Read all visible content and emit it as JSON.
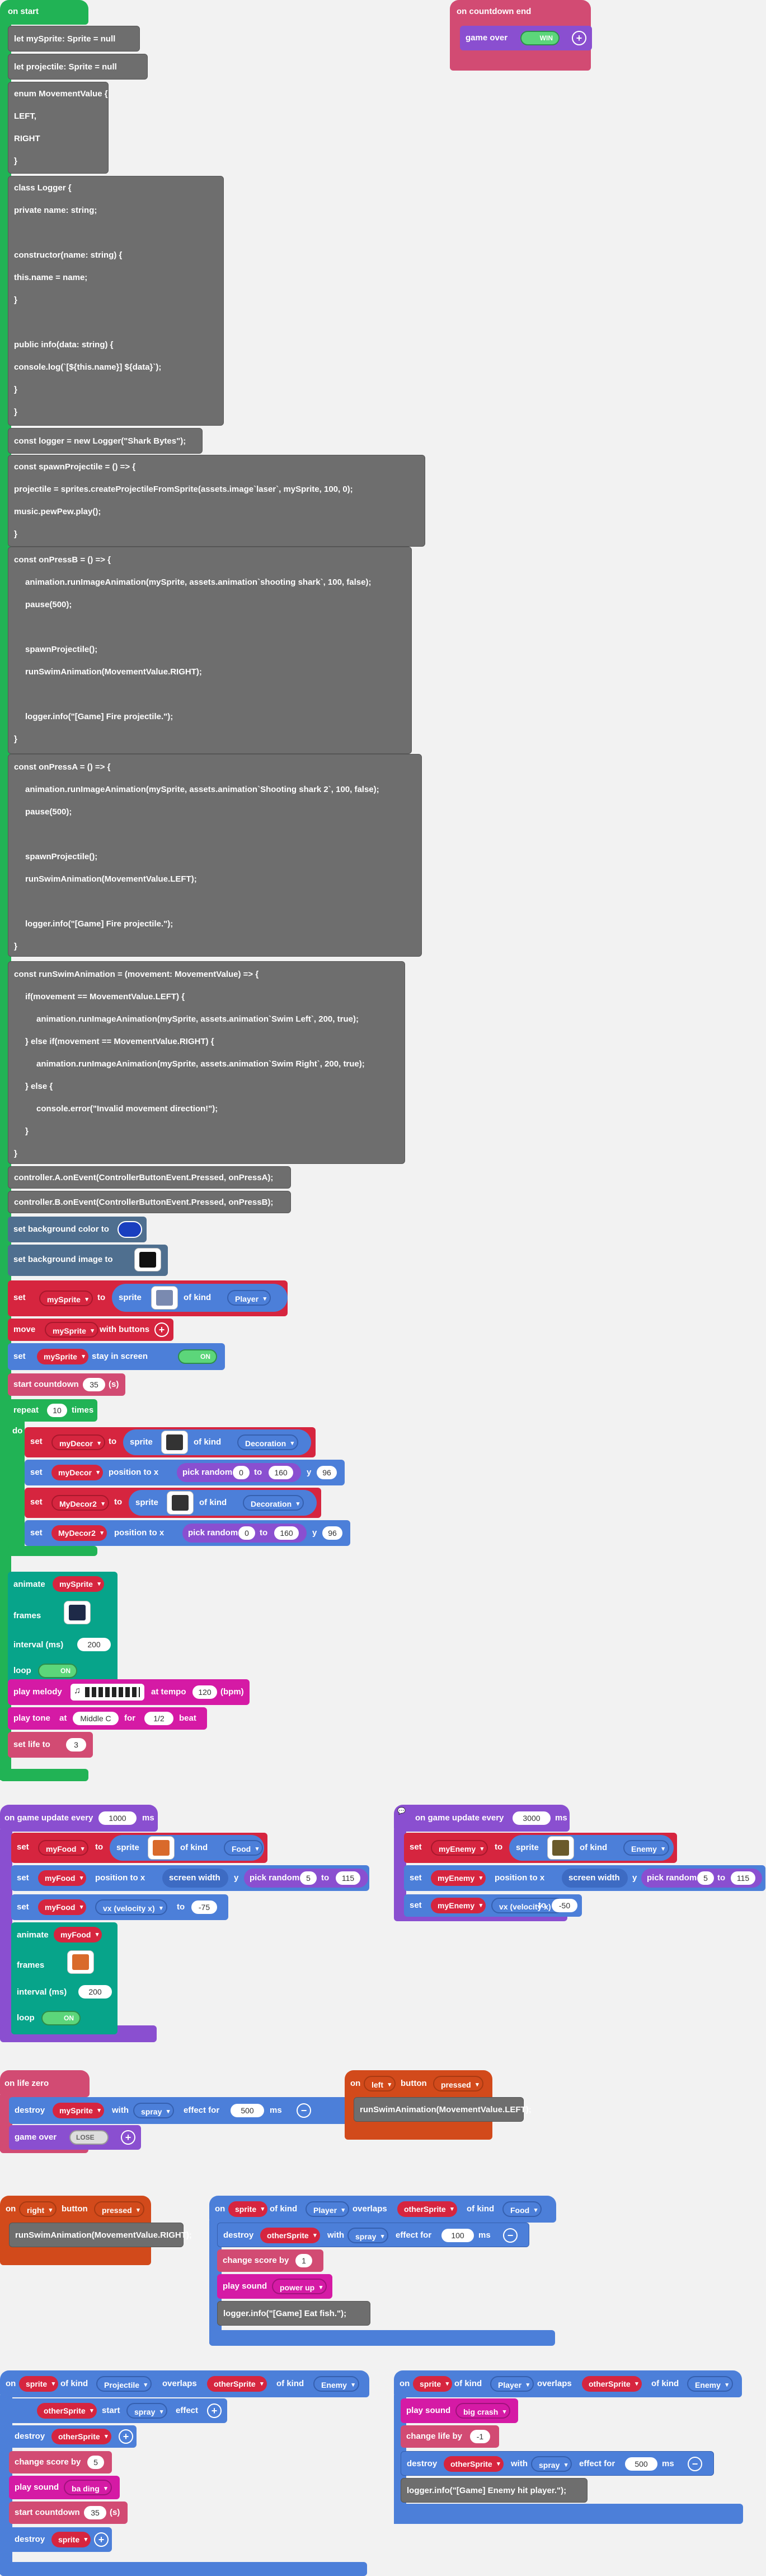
{
  "colors": {
    "code": "#6e6e6e",
    "green": "#21b355",
    "red": "#d6253f",
    "blue": "#4c7fd9",
    "pink": "#d24b73",
    "purple": "#8a4fd0",
    "orange": "#d24a1b",
    "magenta": "#d51aa5"
  },
  "on_start": {
    "label": "on start",
    "code": [
      "let mySprite: Sprite = null",
      "let projectile: Sprite = null",
      "enum MovementValue {",
      "    LEFT,",
      "    RIGHT",
      "}",
      "class Logger {",
      "    private name: string;",
      "    constructor(name: string) {",
      "        this.name = name;",
      "    }",
      "    public info(data: string) {",
      "        console.log(`[${this.name}] ${data}`);",
      "    }",
      "}",
      "const logger = new Logger(\"Shark Bytes\");",
      "const spawnProjectile = () => {",
      "    projectile = sprites.createProjectileFromSprite(assets.image`laser`, mySprite, 100, 0);",
      "    music.pewPew.play();",
      "}",
      "const onPressB = () => {",
      "    animation.runImageAnimation(mySprite, assets.animation`shooting shark`, 100, false);",
      "    pause(500);",
      "    spawnProjectile();",
      "    runSwimAnimation(MovementValue.RIGHT);",
      "    logger.info(\"[Game] Fire projectile.\");",
      "}",
      "const onPressA = () => {",
      "    animation.runImageAnimation(mySprite, assets.animation`Shooting shark 2`, 100, false);",
      "    pause(500);",
      "    spawnProjectile();",
      "    runSwimAnimation(MovementValue.LEFT);",
      "    logger.info(\"[Game] Fire projectile.\");",
      "}",
      "const runSwimAnimation = (movement: MovementValue) => {",
      "    if(movement == MovementValue.LEFT) {",
      "        animation.runImageAnimation(mySprite, assets.animation`Swim Left`, 200, true);",
      "    } else if(movement == MovementValue.RIGHT) {",
      "        animation.runImageAnimation(mySprite, assets.animation`Swim Right`, 200, true);",
      "    } else {",
      "        console.error(\"Invalid movement direction!\");",
      "    }",
      "}",
      "controller.A.onEvent(ControllerButtonEvent.Pressed, onPressA);",
      "controller.B.onEvent(ControllerButtonEvent.Pressed, onPressB);"
    ],
    "set_bg_color": "set background color to",
    "set_bg_image": "set background image to",
    "set": "set",
    "to": "to",
    "sprite": "sprite",
    "of_kind": "of kind",
    "mySprite": "mySprite",
    "Player": "Player",
    "move": "move",
    "with_buttons": "with buttons",
    "stay_in_screen": "stay in screen",
    "on": "ON",
    "off": "OFF",
    "start_countdown": "start countdown",
    "countdown_value": "35",
    "s": "(s)",
    "repeat": "repeat",
    "repeat_value": "10",
    "times": "times",
    "do": "do",
    "myDecor": "myDecor",
    "MyDecor2": "MyDecor2",
    "Decoration": "Decoration",
    "position_to_x": "position to x",
    "pick_random": "pick random",
    "rand_lo": "0",
    "rand_hi": "160",
    "y": "y",
    "y_value": "96",
    "animate": "animate",
    "frames": "frames",
    "interval": "interval (ms)",
    "interval_value": "200",
    "loop": "loop",
    "play_melody": "play melody",
    "at_tempo": "at tempo",
    "tempo_value": "120",
    "bpm": "(bpm)",
    "play_tone": "play tone",
    "at": "at",
    "middle_c": "Middle C",
    "for": "for",
    "half": "1/2",
    "beat": "beat",
    "set_life": "set life to",
    "life_value": "3"
  },
  "countdown_end": {
    "label": "on countdown end",
    "game_over": "game over",
    "win": "WIN"
  },
  "update_food": {
    "on_game_update": "on game update every",
    "ms_value": "1000",
    "ms": "ms",
    "myFood": "myFood",
    "Food": "Food",
    "screen_width": "screen width",
    "rand_lo": "5",
    "rand_hi": "115",
    "vx": "vx (velocity x)",
    "vx_value": "-75"
  },
  "update_enemy": {
    "ms_value": "3000",
    "myEnemy": "myEnemy",
    "Enemy": "Enemy",
    "rand_lo": "5",
    "rand_hi": "115",
    "vx_value": "-50"
  },
  "life_zero": {
    "label": "on life zero",
    "destroy": "destroy",
    "with": "with",
    "spray": "spray",
    "effect_for": "effect for",
    "effect_value": "500",
    "msms": "ms",
    "game_over": "game over",
    "lose": "LOSE"
  },
  "left_pressed": {
    "on": "on",
    "left": "left",
    "button": "button",
    "pressed": "pressed",
    "code": "runSwimAnimation(MovementValue.LEFT);"
  },
  "right_pressed": {
    "on": "on",
    "right": "right",
    "button": "button",
    "pressed": "pressed",
    "code": "runSwimAnimation(MovementValue.RIGHT);"
  },
  "overlap_food": {
    "on": "on",
    "sprite": "sprite",
    "of_kind": "of kind",
    "Player": "Player",
    "overlaps": "overlaps",
    "otherSprite": "otherSprite",
    "Food": "Food",
    "destroy": "destroy",
    "with": "with",
    "spray": "spray",
    "effect_for": "effect for",
    "effect_value": "100",
    "ms": "ms",
    "change_score": "change score by",
    "score_value": "1",
    "play_sound": "play sound",
    "power_up": "power up",
    "log": "logger.info(\"[Game] Eat fish.\");"
  },
  "overlap_projectile": {
    "Projectile": "Projectile",
    "Enemy": "Enemy",
    "start": "start",
    "effect": "effect",
    "score_value": "5",
    "big_sting": "ba ding",
    "countdown_value": "35"
  },
  "overlap_enemy": {
    "big_crash": "big crash",
    "change_life": "change life by",
    "life_value": "-1",
    "effect_value": "500",
    "log": "logger.info(\"[Game] Enemy hit player.\");"
  }
}
